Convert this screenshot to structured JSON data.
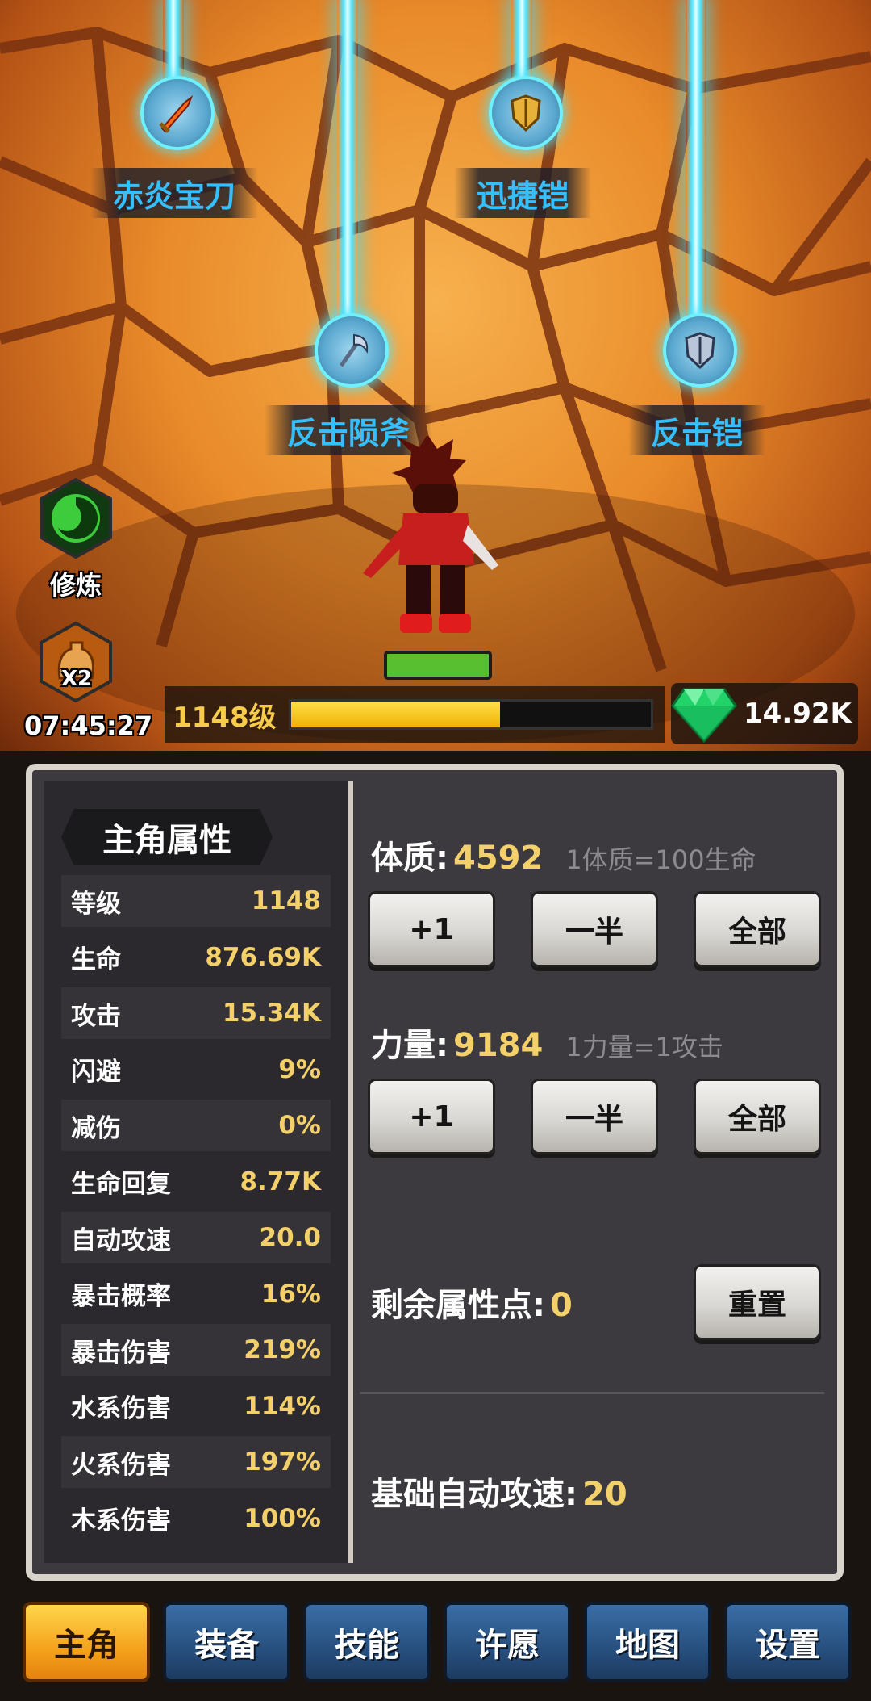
{
  "scene": {
    "equipment": [
      {
        "label": "赤炎宝刀",
        "icon": "flame-sword-icon"
      },
      {
        "label": "迅捷铠",
        "icon": "golden-armor-icon"
      },
      {
        "label": "反击陨斧",
        "icon": "axe-icon"
      },
      {
        "label": "反击铠",
        "icon": "silver-armor-icon"
      }
    ],
    "cultivate_label": "修炼",
    "boost_label": "X2",
    "timer": "07:45:27",
    "level": "1148级",
    "xp_fraction": 0.58,
    "gems": "14.92K"
  },
  "stats": {
    "title": "主角属性",
    "rows": [
      {
        "name": "等级",
        "value": "1148"
      },
      {
        "name": "生命",
        "value": "876.69K"
      },
      {
        "name": "攻击",
        "value": "15.34K"
      },
      {
        "name": "闪避",
        "value": "9%"
      },
      {
        "name": "减伤",
        "value": "0%"
      },
      {
        "name": "生命回复",
        "value": "8.77K"
      },
      {
        "name": "自动攻速",
        "value": "20.0"
      },
      {
        "name": "暴击概率",
        "value": "16%"
      },
      {
        "name": "暴击伤害",
        "value": "219%"
      },
      {
        "name": "水系伤害",
        "value": "114%"
      },
      {
        "name": "火系伤害",
        "value": "197%"
      },
      {
        "name": "木系伤害",
        "value": "100%"
      }
    ]
  },
  "attributes": {
    "constitution": {
      "label": "体质:",
      "value": "4592",
      "hint": "1体质=100生命"
    },
    "strength": {
      "label": "力量:",
      "value": "9184",
      "hint": "1力量=1攻击"
    },
    "buttons": {
      "plus_one": "+1",
      "half": "一半",
      "all": "全部"
    },
    "remaining": {
      "label": "剩余属性点:",
      "value": "0"
    },
    "reset": "重置",
    "base_speed": {
      "label": "基础自动攻速:",
      "value": "20"
    }
  },
  "nav": {
    "tabs": [
      "主角",
      "装备",
      "技能",
      "许愿",
      "地图",
      "设置"
    ],
    "active": 0
  },
  "colors": {
    "accent_gold": "#f4d06a",
    "beam": "#4fe4ff",
    "nav_blue": "#2f5f95",
    "nav_active": "#f5a21c"
  }
}
